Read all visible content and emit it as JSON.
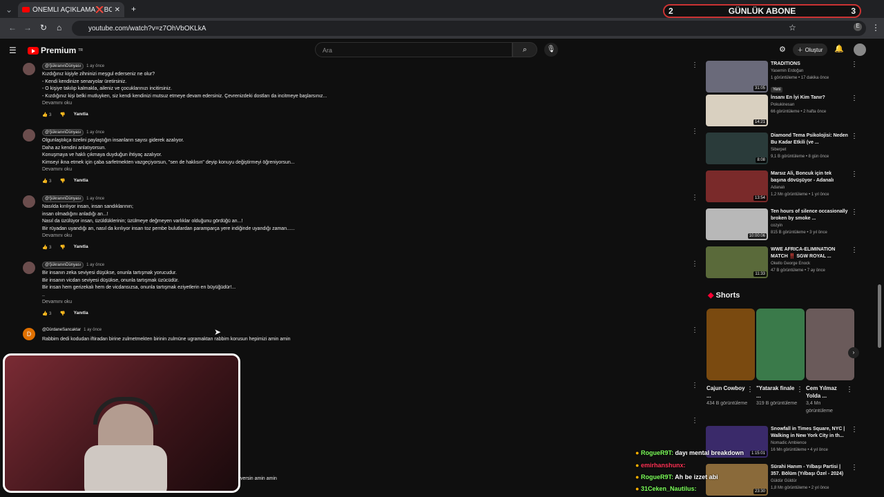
{
  "browser": {
    "tab_title": "ÖNEMLİ AÇIKLAMA❌BOŞA",
    "url": "youtube.com/watch?v=z7OhVbOKLkA",
    "new_tab": "+"
  },
  "overlay": {
    "abone_left": "2",
    "abone_text": "GÜNLÜK ABONE",
    "abone_right": "3"
  },
  "header": {
    "logo": "Premium",
    "region": "TR",
    "search_placeholder": "Ara",
    "create": "Oluştur"
  },
  "comments": [
    {
      "author": "@ŞükranınDünyası",
      "time": "1 ay önce",
      "body": "Kızdığınız kişiyle zihninizi meşgul ederseniz ne olur?\n- Kendi kendinize senaryolar üretirsiniz.\n- O kişiye takılıp kalmakla, aileniz ve çocuklarınızı incitirsiniz.\n- Kızdığınız kişi belki mutluyken, siz kendi kendinizi mutsuz etmeye devam edersiniz. Çevrenizdeki dostları da incitmeye başlarsınız...",
      "more": "Devamını oku",
      "likes": "3",
      "reply": "Yanıtla"
    },
    {
      "author": "@ŞükranınDünyası",
      "time": "1 ay önce",
      "body": "Olgunlaştıkça özelini paylaştığın insanların sayısı giderek azalıyor.\nDaha az kendini anlatıyorsun.\nKonuşmaya ve haklı çıkmaya duyduğun ihtiyaç azalıyor.\nKimseyi ikna etmek için çaba sarfetmekten vazgeçiyorsun, \"sen de haklısın\" deyip konuyu değiştirmeyi öğreniyorsun...",
      "more": "Devamını oku",
      "likes": "3",
      "reply": "Yanıtla"
    },
    {
      "author": "@ŞükranınDünyası",
      "time": "1 ay önce",
      "body": "Nasılda kırılıyor insan, insan sandıklarının;\ninsan olmadığını anladığı an...!\nNasıl da üzülüyor insan, üzüldüklerinin; üzülmeye değmeyen varlıklar olduğunu gördüğü an...!\nBir rüyadan uyandığı an, nasıl da kırılıyor insan toz pembe bulutlardan paramparça yere indiğinde uyandığı zaman......",
      "more": "Devamını oku",
      "likes": "3",
      "reply": "Yanıtla"
    },
    {
      "author": "@ŞükranınDünyası",
      "time": "1 ay önce",
      "body": "Bir insanın zeka seviyesi düşükse, onunla tartışmak yorucudur.\nBir insanın vicdan seviyesi düşükse, onunla tartışmak üzücüdür.\nBir insan hem gerizekalı hem de vicdansızsa, onunla tartışmak eziyetlerin en büyüğüdür!...\n..",
      "more": "Devamını oku",
      "likes": "3",
      "reply": "Yanıtla"
    },
    {
      "author": "@DürdaneSancaktar",
      "time": "1 ay önce",
      "body": "Rabbim dedi kodudan iftiradan birine zulmetmekten birinin zulmüne ugramaktan rabbim korusun hepimizi amin amin",
      "avatar_letter": "D"
    }
  ],
  "comment_tail": "versin amin amin",
  "videos": [
    {
      "title": "TRADITIONS",
      "channel": "Yasemin Erdoğan",
      "meta": "1 görüntüleme • 17 dakika önce",
      "badge": "Yeni",
      "duration": "31:05",
      "color": "#6a6a7a"
    },
    {
      "title": "İnsanı En İyi Kim Tanır?",
      "channel": "Pokukinesan",
      "meta": "66 görüntüleme • 2 hafta önce",
      "duration": "14:21",
      "color": "#d9d0c0"
    },
    {
      "title": "Diamond Tema Psikolojisi: Neden Bu Kadar Etkili (ve ...",
      "channel": "Siberpet",
      "meta": "9,1 B görüntüleme • 8 gün önce",
      "duration": "8:08",
      "color": "#2a3b3a"
    },
    {
      "title": "Marsız Ali, Boncuk için tek başına dövüşüyor - Adanalı",
      "channel": "Adanalı",
      "meta": "1,2 Mn görüntüleme • 1 yıl önce",
      "duration": "13:54",
      "color": "#7a2a2a"
    },
    {
      "title": "Ten hours of silence occasionally broken by smoke ...",
      "channel": "cozyin",
      "meta": "815 B görüntüleme • 3 yıl önce",
      "duration": "10:00:06",
      "color": "#b8b8b8"
    },
    {
      "title": "WWE AFRICA-ELIMINATION MATCH ‼️ SGW ROYAL ...",
      "channel": "Okello George Enock",
      "meta": "47 B görüntüleme • 7 ay önce",
      "duration": "11:33",
      "color": "#5a6a3a"
    },
    {
      "title": "Snowfall in Times Square, NYC | Walking in New York City in th...",
      "channel": "Nomadic Ambience",
      "meta": "16 Mn görüntüleme • 4 yıl önce",
      "duration": "1:15:01",
      "color": "#3a2a6a"
    },
    {
      "title": "Sürahi Hanım - Yılbaşı Partisi | 357. Bölüm (Yılbaşı Özel - 2024)",
      "channel": "Güldür Güldür",
      "meta": "1,8 Mn görüntüleme • 2 yıl önce",
      "duration": "23:30",
      "color": "#8a6a3a"
    }
  ],
  "shorts": {
    "heading": "Shorts",
    "items": [
      {
        "title": "Cajun Cowboy ...",
        "views": "434 B görüntüleme",
        "color": "#7a4a10"
      },
      {
        "title": "\"Yatarak finale ...",
        "views": "319 B görüntüleme",
        "color": "#3a7a4a"
      },
      {
        "title": "Cem Yılmaz Yolda ...",
        "views": "3,4 Mn görüntüleme",
        "color": "#6a5a5a"
      }
    ]
  },
  "chat": [
    {
      "user": "RogueR9T:",
      "msg": "dayı mental breakdown",
      "color": "#7cff5a"
    },
    {
      "user": "emirhanshunx:",
      "msg": "",
      "color": "#ff3355"
    },
    {
      "user": "RogueR9T:",
      "msg": "Ah be izzet abi",
      "color": "#7cff5a"
    },
    {
      "user": "31Ceken_Nautilus:",
      "msg": "",
      "color": "#7cff5a"
    }
  ]
}
